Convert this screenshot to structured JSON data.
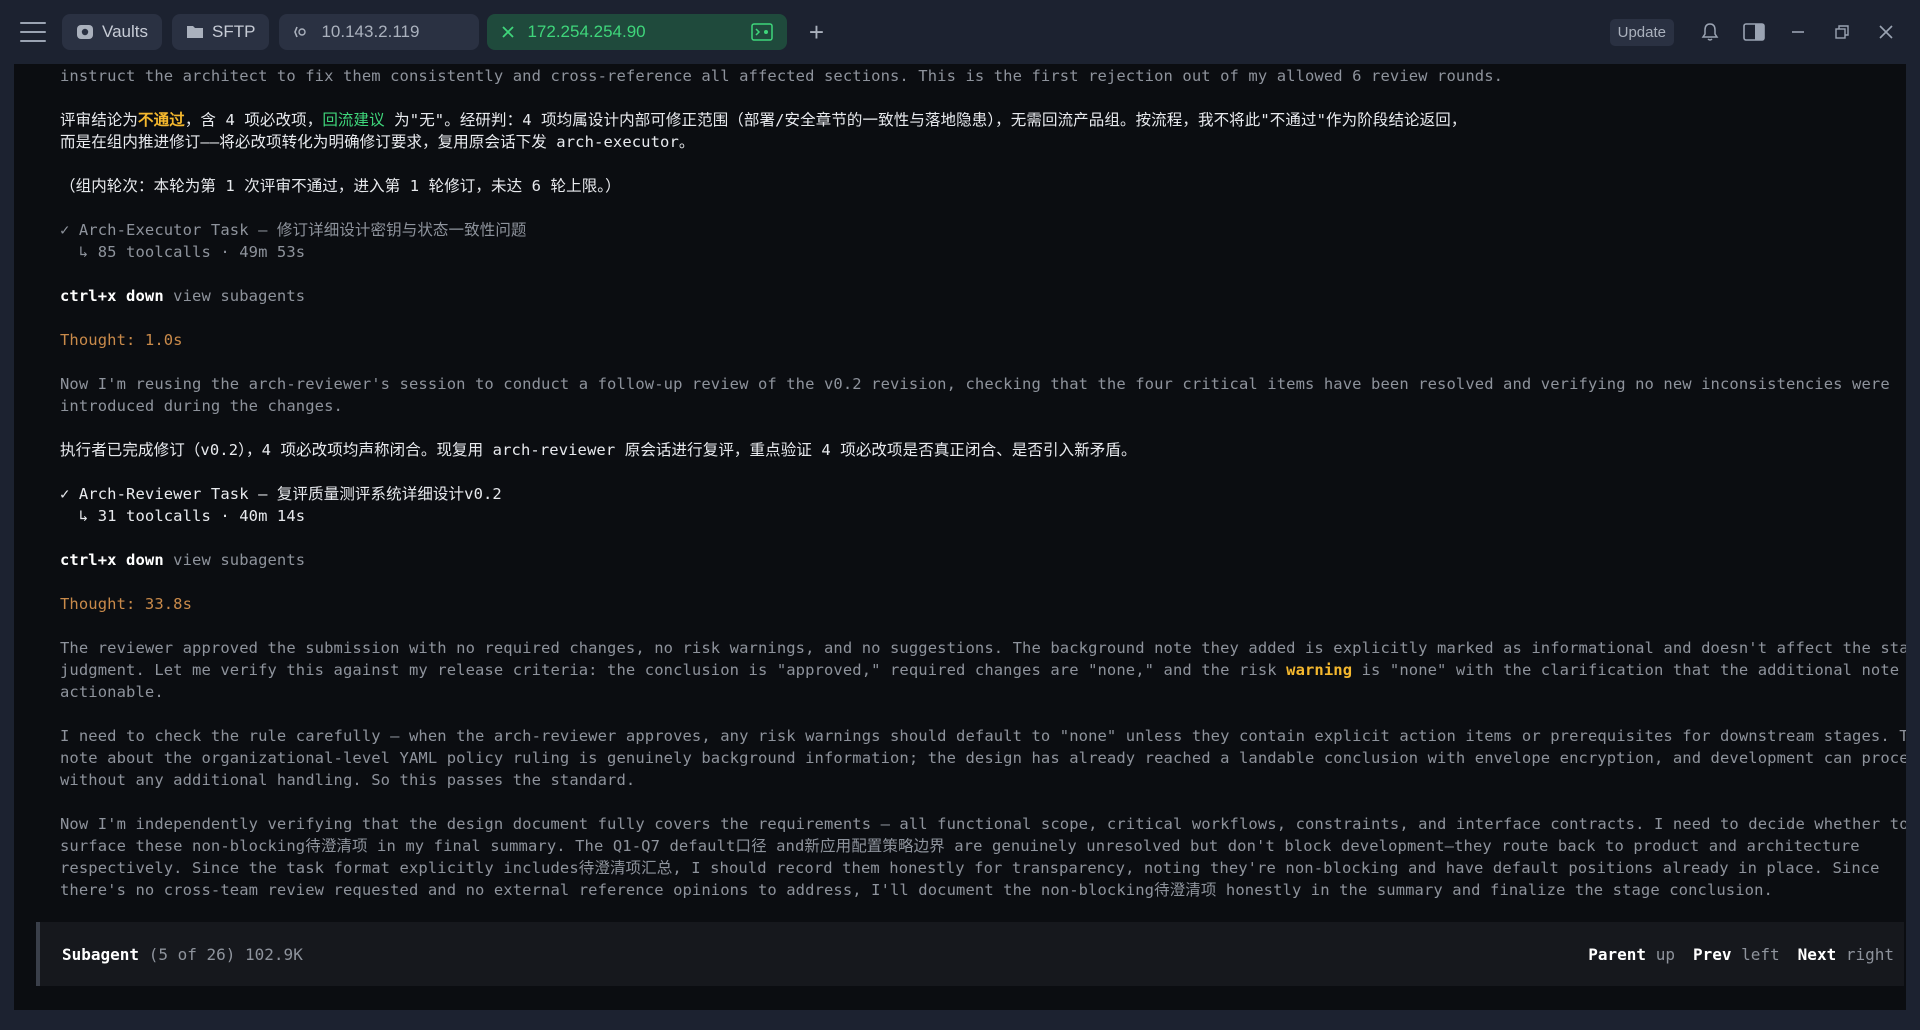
{
  "topbar": {
    "vaults_label": "Vaults",
    "sftp_label": "SFTP",
    "tabs": [
      {
        "label": "10.143.2.119",
        "active": false
      },
      {
        "label": "172.254.254.90",
        "active": true
      }
    ],
    "update_label": "Update"
  },
  "log": {
    "l01": "instruct the architect to fix them consistently and cross-reference all affected sections. This is the first rejection out of my allowed 6 review rounds.",
    "l02a": "评审结论为",
    "l02b": "不通过",
    "l02c": "，含 4 项必改项，",
    "l02d": "回流建议",
    "l02e": " 为\"无\"。经研判：4 项均属设计内部可修正范围（部署/安全章节的一致性与落地隐患），无需回流产品组。按流程，我不将此\"不通过\"作为阶段结论返回，",
    "l03": "而是在组内推进修订——将必改项转化为明确修订要求，复用原会话下发 arch-executor。",
    "l04": "（组内轮次：本轮为第 1 次评审不通过，进入第 1 轮修订，未达 6 轮上限。）",
    "l05": "✓ Arch-Executor Task — 修订详细设计密钥与状态一致性问题",
    "l06": "  ↳ 85 toolcalls · 49m 53s",
    "l07a": "ctrl+x down",
    "l07b": " view subagents",
    "l08": "Thought: 1.0s",
    "l09": "Now I'm reusing the arch-reviewer's session to conduct a follow-up review of the v0.2 revision, checking that the four critical items have been resolved and verifying no new inconsistencies were",
    "l10": "introduced during the changes.",
    "l11": "执行者已完成修订（v0.2），4 项必改项均声称闭合。现复用 arch-reviewer 原会话进行复评，重点验证 4 项必改项是否真正闭合、是否引入新矛盾。",
    "l12": "✓ Arch-Reviewer Task — 复评质量测评系统详细设计v0.2",
    "l13": "  ↳ 31 toolcalls · 40m 14s",
    "l14a": "ctrl+x down",
    "l14b": " view subagents",
    "l15": "Thought: 33.8s",
    "l16": "The reviewer approved the submission with no required changes, no risk warnings, and no suggestions. The background note they added is explicitly marked as informational and doesn't affect the stage",
    "l17a": "judgment. Let me verify this against my release criteria: the conclusion is \"approved,\" required changes are \"none,\" and the risk ",
    "l17b": "warning",
    "l17c": " is \"none\" with the clarification that the additional note is non-",
    "l18": "actionable.",
    "l19": "I need to check the rule carefully — when the arch-reviewer approves, any risk warnings should default to \"none\" unless they contain explicit action items or prerequisites for downstream stages. This",
    "l20": "note about the organizational-level YAML policy ruling is genuinely background information; the design has already reached a landable conclusion with envelope encryption, and development can proceed",
    "l21": "without any additional handling. So this passes the standard.",
    "l22": "Now I'm independently verifying that the design document fully covers the requirements — all functional scope, critical workflows, constraints, and interface contracts. I need to decide whether to",
    "l23": "surface these non-blocking待澄清项 in my final summary. The Q1-Q7 default口径 and新应用配置策略边界 are genuinely unresolved but don't block development—they route back to product and architecture",
    "l24": "respectively. Since the task format explicitly includes待澄清项汇总, I should record them honestly for transparency, noting they're non-blocking and have default positions already in place. Since",
    "l25": "there's no cross-team review requested and no external reference opinions to address, I'll document the non-blocking待澄清项 honestly in the summary and finalize the stage conclusion."
  },
  "status": {
    "title": "Subagent",
    "meta": " (5 of 26) 102.9K",
    "parent_key": "Parent",
    "parent_hint": " up",
    "prev_key": "Prev",
    "prev_hint": " left",
    "next_key": "Next",
    "next_hint": " right"
  },
  "colors": {
    "accent_green": "#3fd67b",
    "warning_yellow": "#f5b82e",
    "thought_orange": "#c98a4a"
  }
}
